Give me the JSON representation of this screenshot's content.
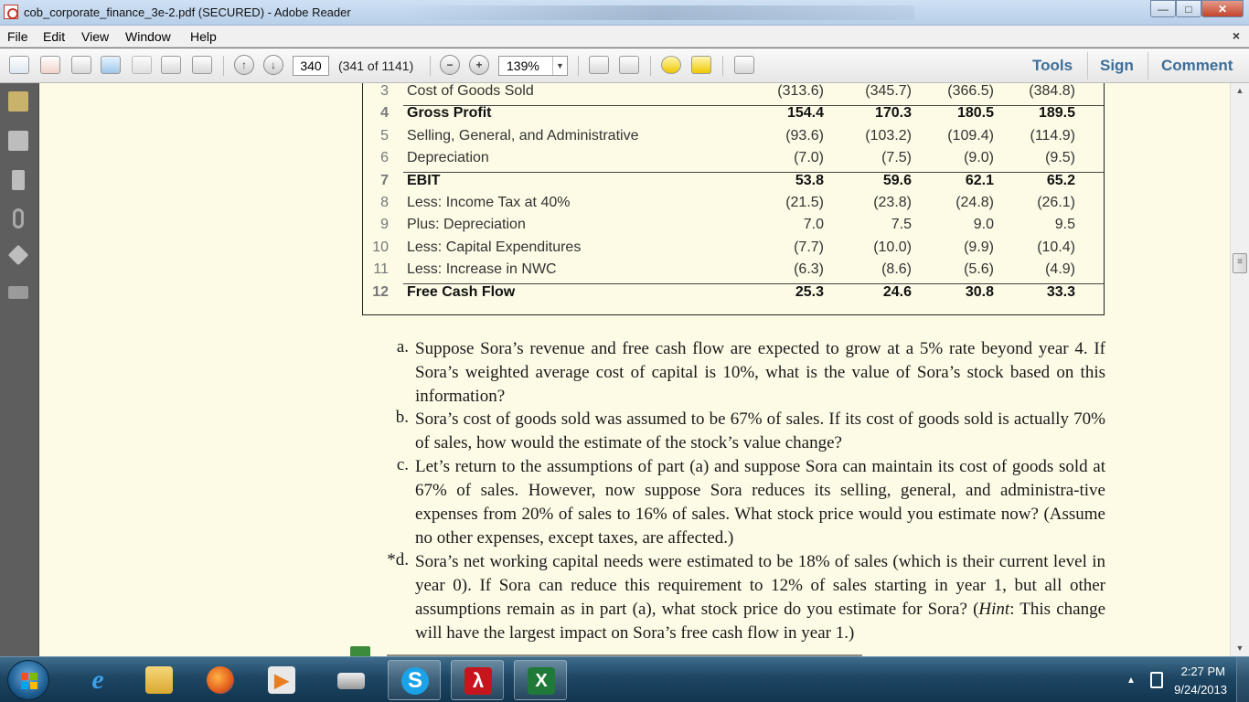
{
  "window": {
    "title": "cob_corporate_finance_3e-2.pdf (SECURED) - Adobe Reader",
    "controls": [
      "minimize",
      "maximize",
      "close"
    ]
  },
  "menubar": {
    "items": [
      "File",
      "Edit",
      "View",
      "Window",
      "Help"
    ],
    "close_glyph": "×"
  },
  "toolbar": {
    "page_number": "340",
    "page_of": "(341 of 1141)",
    "zoom": "139%",
    "links": [
      "Tools",
      "Sign",
      "Comment"
    ]
  },
  "table": {
    "rows": [
      {
        "num": "3",
        "label": "Cost of Goods Sold",
        "values": [
          "(313.6)",
          "(345.7)",
          "(366.5)",
          "(384.8)"
        ],
        "bold": false
      },
      {
        "num": "4",
        "label": "Gross Profit",
        "values": [
          "154.4",
          "170.3",
          "180.5",
          "189.5"
        ],
        "bold": true
      },
      {
        "num": "5",
        "label": "Selling, General, and Administrative",
        "values": [
          "(93.6)",
          "(103.2)",
          "(109.4)",
          "(114.9)"
        ],
        "bold": false
      },
      {
        "num": "6",
        "label": "Depreciation",
        "values": [
          "(7.0)",
          "(7.5)",
          "(9.0)",
          "(9.5)"
        ],
        "bold": false
      },
      {
        "num": "7",
        "label": "EBIT",
        "values": [
          "53.8",
          "59.6",
          "62.1",
          "65.2"
        ],
        "bold": true
      },
      {
        "num": "8",
        "label": "Less: Income Tax at 40%",
        "values": [
          "(21.5)",
          "(23.8)",
          "(24.8)",
          "(26.1)"
        ],
        "bold": false
      },
      {
        "num": "9",
        "label": "Plus: Depreciation",
        "values": [
          "7.0",
          "7.5",
          "9.0",
          "9.5"
        ],
        "bold": false
      },
      {
        "num": "10",
        "label": "Less: Capital Expenditures",
        "values": [
          "(7.7)",
          "(10.0)",
          "(9.9)",
          "(10.4)"
        ],
        "bold": false
      },
      {
        "num": "11",
        "label": "Less: Increase in NWC",
        "values": [
          "(6.3)",
          "(8.6)",
          "(5.6)",
          "(4.9)"
        ],
        "bold": false
      },
      {
        "num": "12",
        "label": "Free Cash Flow",
        "values": [
          "25.3",
          "24.6",
          "30.8",
          "33.3"
        ],
        "bold": true
      }
    ]
  },
  "questions": [
    {
      "letter": "a.",
      "text": "Suppose Sora’s revenue and free cash flow are expected to grow at a 5% rate beyond year 4. If Sora’s weighted average cost of capital is 10%, what is the value of Sora’s stock based on this information?"
    },
    {
      "letter": "b.",
      "text": "Sora’s cost of goods sold was assumed to be 67% of sales. If its cost of goods sold is actually 70% of sales, how would the estimate of the stock’s value change?"
    },
    {
      "letter": "c.",
      "text": "Let’s return to the assumptions of part (a) and suppose Sora can maintain its cost of goods sold at 67% of sales. However, now suppose Sora reduces its selling, general, and administra-tive expenses from 20% of sales to 16% of sales. What stock price would you estimate now? (Assume no other expenses, except taxes, are affected.)"
    },
    {
      "letter": "*d.",
      "text_pre": "Sora’s net working capital needs were estimated to be 18% of sales (which is their current level in year 0). If Sora can reduce this requirement to 12% of sales starting in year 1, but all other assumptions remain as in part (a), what stock price do you estimate for Sora? (",
      "hint": "Hint",
      "text_post": ": This change will have the largest impact on Sora’s free cash flow in year 1.)"
    }
  ],
  "taskbar": {
    "apps": [
      "Internet Explorer",
      "Windows Explorer",
      "Firefox",
      "Media Player",
      "Scanner",
      "Skype",
      "Adobe Reader",
      "Excel"
    ],
    "time": "2:27 PM",
    "date": "9/24/2013"
  },
  "colors": {
    "page_bg": "#fdfbe6",
    "toolbar_link": "#3c6e99",
    "taskbar": "#1d4663"
  }
}
